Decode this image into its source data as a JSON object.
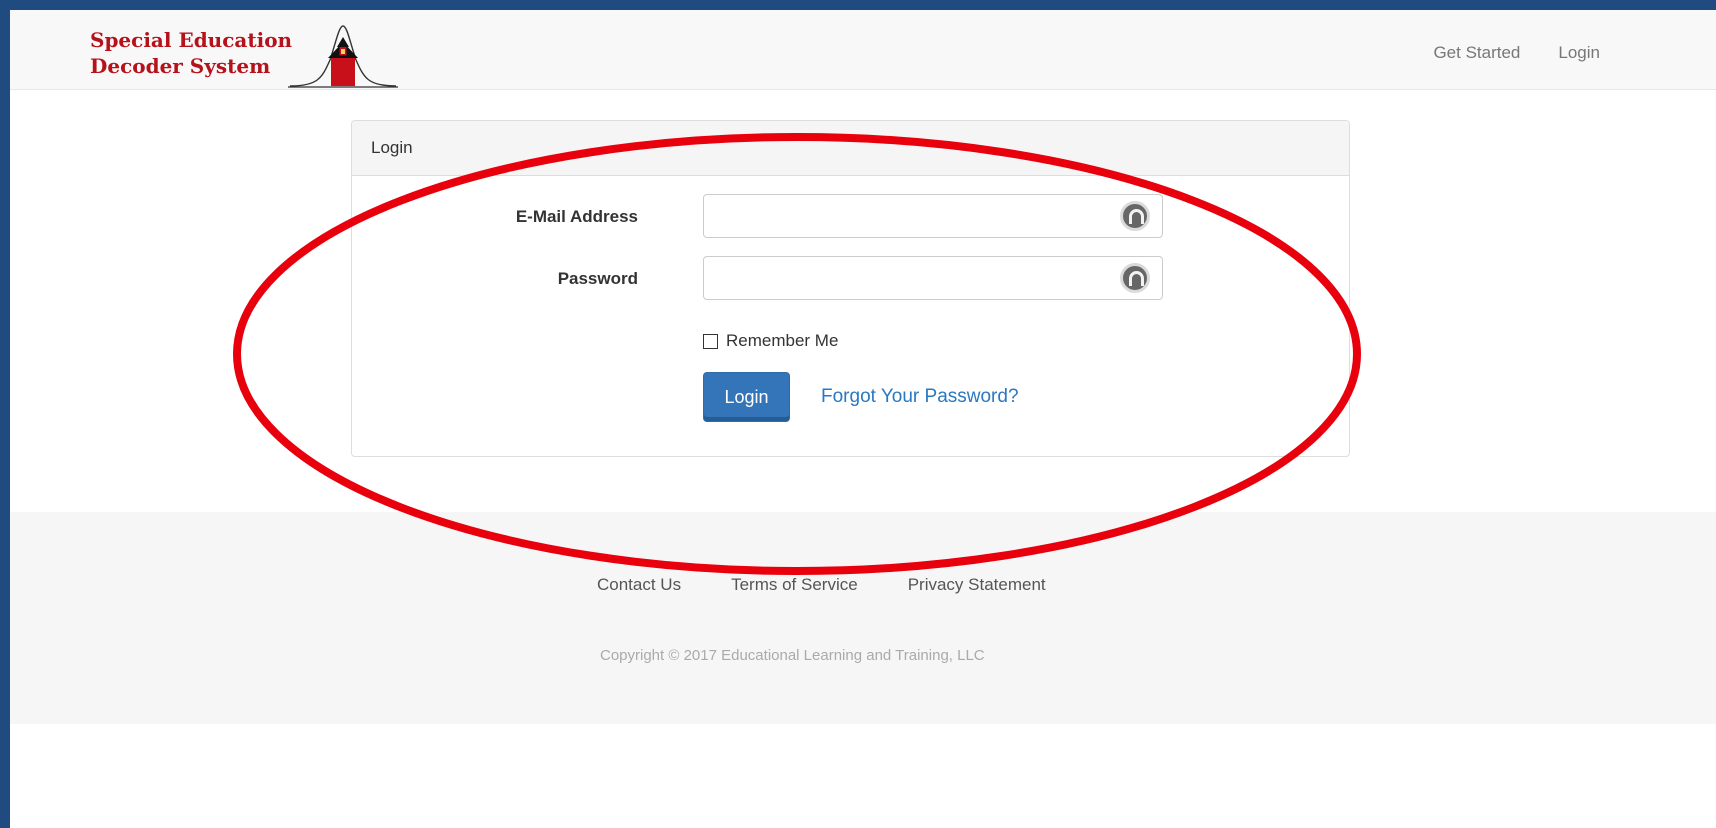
{
  "brand": {
    "line1": "Special Education",
    "line2": "Decoder System",
    "color": "#b5121b",
    "icon": "schoolhouse-bell-curve-logo"
  },
  "nav": {
    "get_started": "Get Started",
    "login": "Login"
  },
  "login_panel": {
    "heading": "Login",
    "email_label": "E-Mail Address",
    "email_value": "",
    "email_icon": "password-manager-icon",
    "password_label": "Password",
    "password_value": "",
    "password_icon": "password-manager-icon",
    "remember_label": "Remember Me",
    "remember_checked": false,
    "submit_label": "Login",
    "forgot_label": "Forgot Your Password?",
    "primary_color": "#3375b8",
    "link_color": "#2a78c2"
  },
  "footer": {
    "links": [
      "Contact Us",
      "Terms of Service",
      "Privacy Statement"
    ],
    "copyright": "Copyright © 2017 Educational Learning and Training, LLC"
  },
  "annotation": {
    "shape": "ellipse",
    "color": "#e8000d"
  },
  "frame_color": "#1f4b80"
}
